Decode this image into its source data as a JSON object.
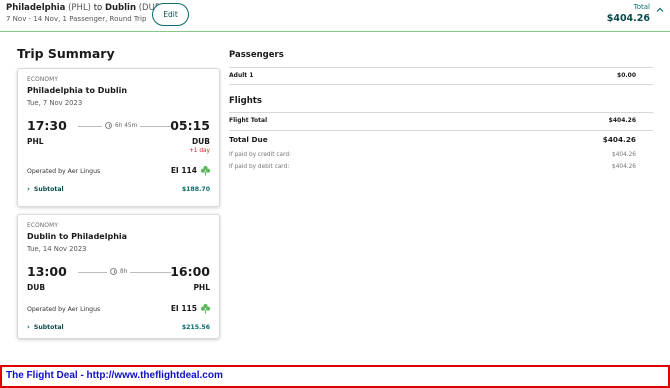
{
  "header": {
    "origin_city": "Philadelphia",
    "origin_code": "(PHL)",
    "to_word": "to",
    "dest_city": "Dublin",
    "dest_code": "(DUB)",
    "subtitle": "7 Nov - 14 Nov, 1 Passenger, Round Trip",
    "edit_label": "Edit",
    "total_label": "Total",
    "total_value": "$404.26",
    "toggle_icon": "chevron-up-icon"
  },
  "trip_summary": {
    "title": "Trip Summary",
    "flights": [
      {
        "cabin": "ECONOMY",
        "route": "Philadelphia to Dublin",
        "date": "Tue, 7 Nov 2023",
        "dep_time": "17:30",
        "arr_time": "05:15",
        "duration": "6h 45m",
        "dep_code": "PHL",
        "arr_code": "DUB",
        "day_offset": "+1 day",
        "operated_by": "Operated by Aer Lingus",
        "flight_number": "EI 114",
        "subtotal_label": "Subtotal",
        "subtotal_value": "$188.70"
      },
      {
        "cabin": "ECONOMY",
        "route": "Dublin to Philadelphia",
        "date": "Tue, 14 Nov 2023",
        "dep_time": "13:00",
        "arr_time": "16:00",
        "duration": "8h",
        "dep_code": "DUB",
        "arr_code": "PHL",
        "operated_by": "Operated by Aer Lingus",
        "flight_number": "EI 115",
        "subtotal_label": "Subtotal",
        "subtotal_value": "$215.56"
      }
    ]
  },
  "passengers": {
    "title": "Passengers",
    "rows": [
      {
        "label": "Adult 1",
        "value": "$0.00"
      }
    ]
  },
  "flights_section": {
    "title": "Flights",
    "flight_total_label": "Flight Total",
    "flight_total_value": "$404.26",
    "total_due_label": "Total Due",
    "total_due_value": "$404.26",
    "credit_label": "If paid by credit card:",
    "credit_value": "$404.26",
    "debit_label": "If paid by debit card:",
    "debit_value": "$404.26"
  },
  "banner": {
    "text": "The Flight Deal - http://www.theflightdeal.com"
  },
  "colors": {
    "accent": "#0b6b6b",
    "header_rule": "#86c78a",
    "shamrock": "#5cb85c",
    "warning": "#c62828",
    "banner_border": "#e00000",
    "banner_text": "#1010c8"
  }
}
